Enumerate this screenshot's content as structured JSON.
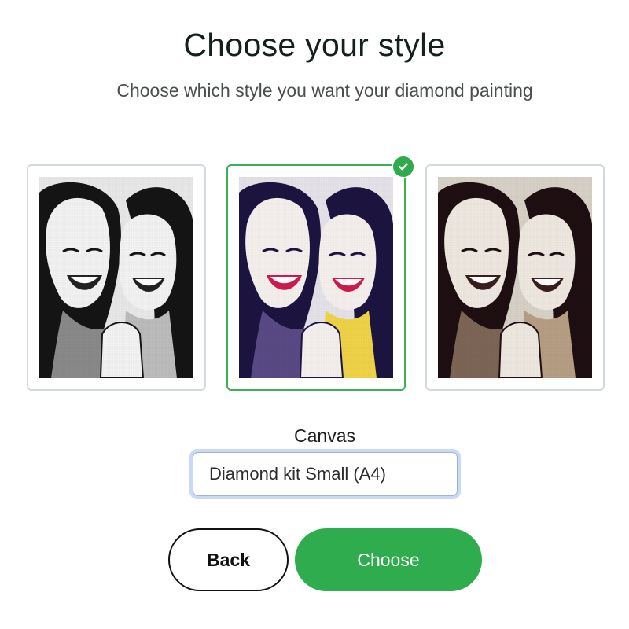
{
  "header": {
    "title": "Choose your style",
    "subtitle": "Choose which style you want your diamond painting"
  },
  "styles": [
    {
      "name": "black-white",
      "selected": false,
      "palette": {
        "bg": "#e9e9e9",
        "hair": "#151515",
        "skin": "#f4f4f4",
        "shade": "#8a8a8a",
        "lips": "#222222",
        "accent": "#bdbdbd"
      }
    },
    {
      "name": "pop-color",
      "selected": true,
      "palette": {
        "bg": "#e6e4ea",
        "hair": "#1c1540",
        "skin": "#f6f1ee",
        "shade": "#5a4a86",
        "lips": "#d11a4f",
        "accent": "#f1d548"
      }
    },
    {
      "name": "sepia",
      "selected": false,
      "palette": {
        "bg": "#d8d2c8",
        "hair": "#1e0f12",
        "skin": "#efe9e2",
        "shade": "#7e6656",
        "lips": "#3a1e1e",
        "accent": "#b79f84"
      }
    }
  ],
  "canvas": {
    "label": "Canvas",
    "selected_value": "Diamond kit Small (A4)"
  },
  "actions": {
    "back_label": "Back",
    "choose_label": "Choose"
  }
}
